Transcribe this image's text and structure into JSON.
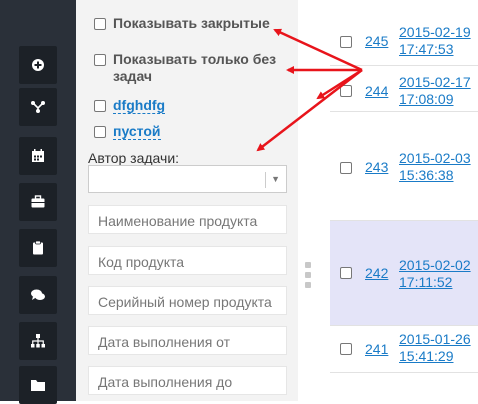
{
  "sidebar": {
    "items": [
      {
        "icon": "plus-circle-icon"
      },
      {
        "icon": "fork-icon"
      },
      {
        "icon": "calendar-icon"
      },
      {
        "icon": "briefcase-icon"
      },
      {
        "icon": "clipboard-icon"
      },
      {
        "icon": "comments-icon"
      },
      {
        "icon": "sitemap-icon"
      },
      {
        "icon": "folder-icon"
      }
    ]
  },
  "filter": {
    "show_closed_label": "Показывать закрытые",
    "show_without_tasks_label": "Показывать только без задач",
    "tags": [
      "dfghdfg",
      "пустой"
    ],
    "author_label": "Автор задачи:",
    "author_value": "",
    "fields": [
      "Наименование продукта",
      "Код продукта",
      "Серийный номер продукта",
      "Дата выполнения от",
      "Дата выполнения до"
    ]
  },
  "tasks": [
    {
      "id": "245",
      "date": "2015-02-19",
      "time": "17:47:53",
      "highlighted": false
    },
    {
      "id": "244",
      "date": "2015-02-17",
      "time": "17:08:09",
      "highlighted": false
    },
    {
      "id": "243",
      "date": "2015-02-03",
      "time": "15:36:38",
      "highlighted": false
    },
    {
      "id": "242",
      "date": "2015-02-02",
      "time": "17:11:52",
      "highlighted": true
    },
    {
      "id": "241",
      "date": "2015-01-26",
      "time": "15:41:29",
      "highlighted": false
    }
  ],
  "colors": {
    "arrow": "#e8141b",
    "link": "#1a7bc7",
    "sidebar": "#2a3039",
    "highlight": "#e4e4f8"
  }
}
